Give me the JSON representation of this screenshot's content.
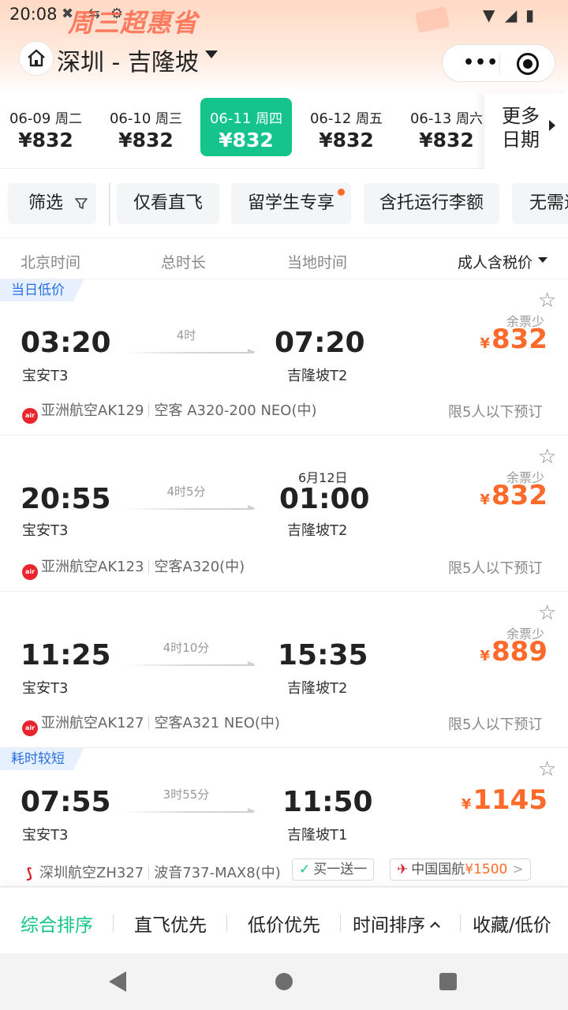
{
  "status_bar": {
    "time": "20:08"
  },
  "promo": {
    "text": "周三超惠省"
  },
  "header": {
    "route_title": "深圳 - 吉隆坡"
  },
  "date_strip": {
    "items": [
      {
        "date": "06-09",
        "weekday": "周二",
        "price": "¥832",
        "active": false
      },
      {
        "date": "06-10",
        "weekday": "周三",
        "price": "¥832",
        "active": false
      },
      {
        "date": "06-11",
        "weekday": "周四",
        "price": "¥832",
        "active": true
      },
      {
        "date": "06-12",
        "weekday": "周五",
        "price": "¥832",
        "active": false
      },
      {
        "date": "06-13",
        "weekday": "周六",
        "price": "¥832",
        "active": false
      }
    ],
    "more_label": "更多日期"
  },
  "filters": {
    "filter_label": "筛选",
    "chips": [
      "仅看直飞",
      "留学生专享",
      "含托运行李额",
      "无需退"
    ]
  },
  "columns": {
    "beijing_time": "北京时间",
    "total_duration": "总时长",
    "local_time": "当地时间",
    "sort_label": "成人含税价"
  },
  "flights": [
    {
      "tag": "当日低价",
      "dep_time": "03:20",
      "dep_airport": "宝安T3",
      "duration": "4时",
      "arr_time": "07:20",
      "arr_airport": "吉隆坡T2",
      "next_day": "",
      "seats_note": "余票少",
      "price": "832",
      "airline": "亚洲航空AK129",
      "aircraft": "空客 A320-200 NEO(中)",
      "limit": "限5人以下预订"
    },
    {
      "tag": "",
      "dep_time": "20:55",
      "dep_airport": "宝安T3",
      "duration": "4时5分",
      "arr_time": "01:00",
      "arr_airport": "吉隆坡T2",
      "next_day": "6月12日",
      "seats_note": "余票少",
      "price": "832",
      "airline": "亚洲航空AK123",
      "aircraft": "空客A320(中)",
      "limit": "限5人以下预订"
    },
    {
      "tag": "",
      "dep_time": "11:25",
      "dep_airport": "宝安T3",
      "duration": "4时10分",
      "arr_time": "15:35",
      "arr_airport": "吉隆坡T2",
      "next_day": "",
      "seats_note": "余票少",
      "price": "889",
      "airline": "亚洲航空AK127",
      "aircraft": "空客A321 NEO(中)",
      "limit": "限5人以下预订"
    },
    {
      "tag": "耗时较短",
      "dep_time": "07:55",
      "dep_airport": "宝安T3",
      "duration": "3时55分",
      "arr_time": "11:50",
      "arr_airport": "吉隆坡T1",
      "next_day": "",
      "seats_note": "",
      "price": "1145",
      "airline": "深圳航空ZH327",
      "aircraft": "波音737-MAX8(中)",
      "badge_promo": "买一送一",
      "badge_partner": "中国国航",
      "badge_partner_price": "¥1500"
    }
  ],
  "sort_bar": {
    "options": [
      "综合排序",
      "直飞优先",
      "低价优先",
      "时间排序",
      "收藏/低价"
    ]
  },
  "currency_symbol": "¥",
  "colors": {
    "accent": "#14c48a",
    "price": "#ff6a2b",
    "tag_bg": "#e6f0ff",
    "tag_text": "#2a6fe0"
  }
}
